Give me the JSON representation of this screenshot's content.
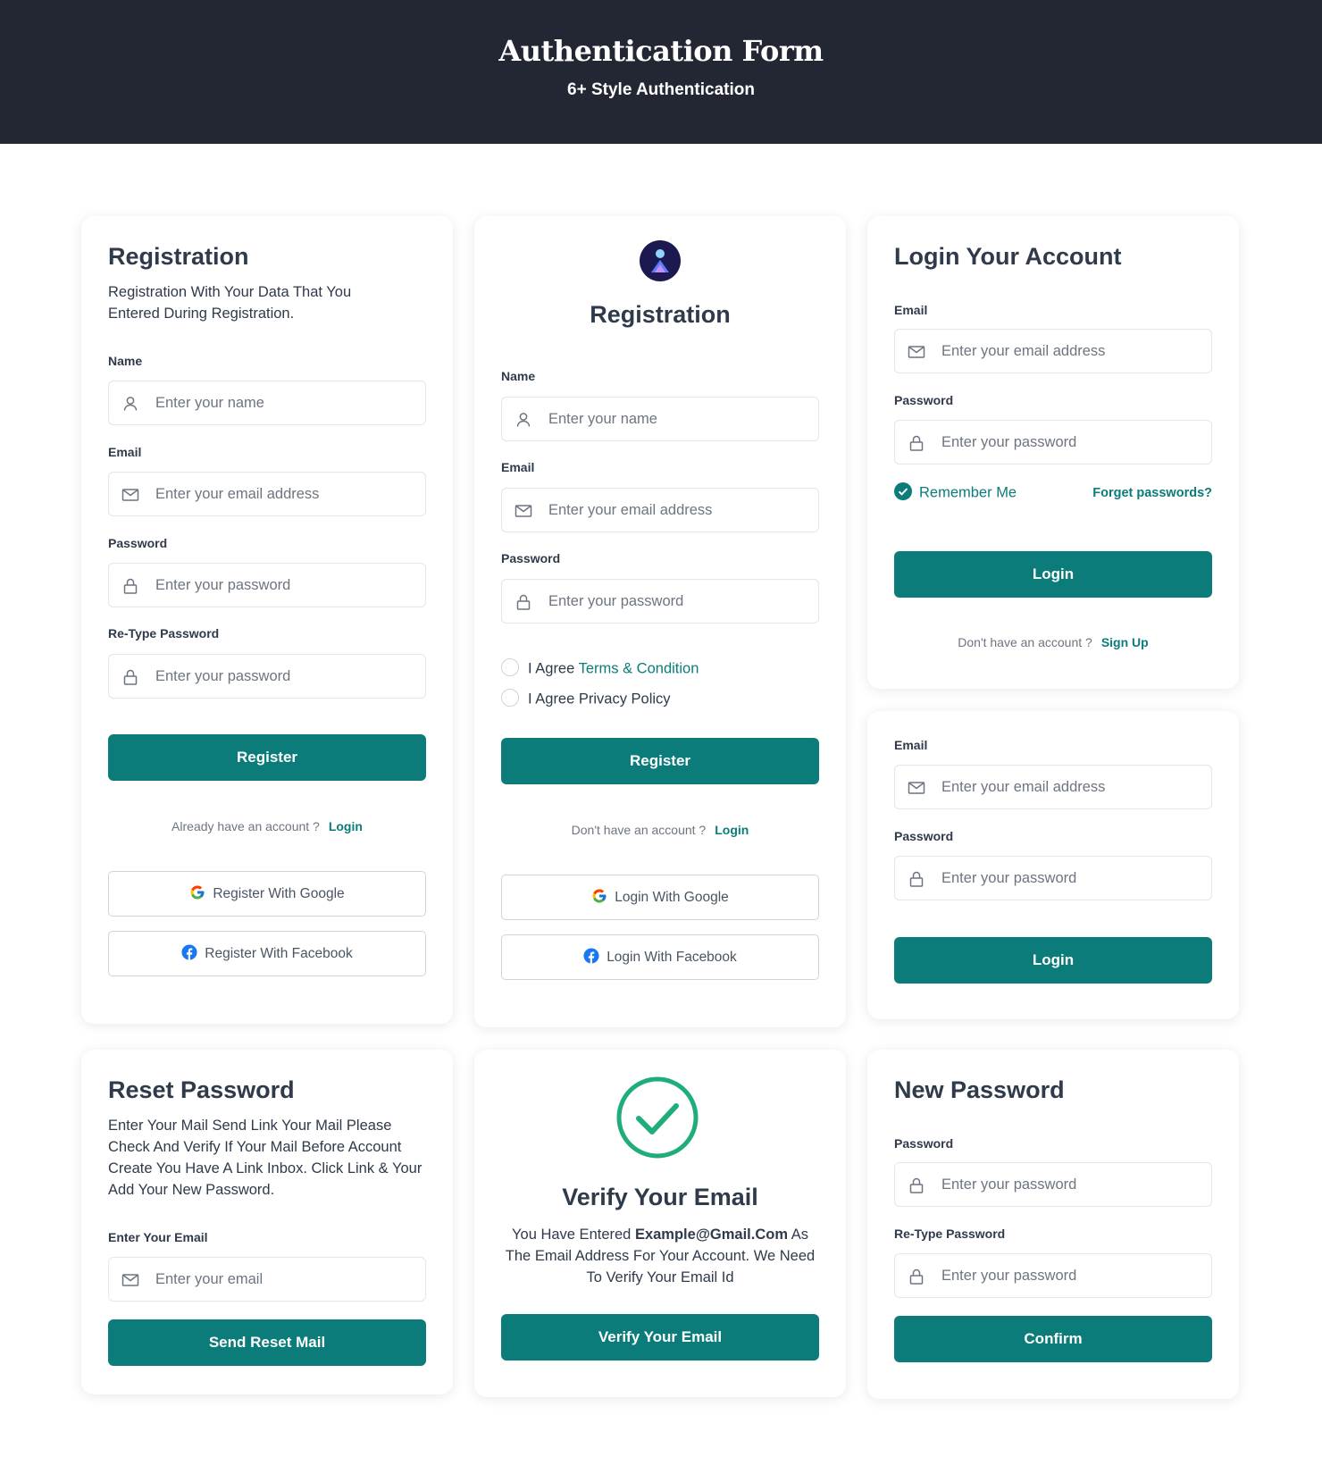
{
  "header": {
    "title": "Authentication Form",
    "subtitle": "6+ Style Authentication"
  },
  "colors": {
    "accent": "#0b7c7a",
    "header_bg": "#222733",
    "success": "#1fae79"
  },
  "registration1": {
    "title": "Registration",
    "description": "Registration With Your Data That You Entered During Registration.",
    "name_label": "Name",
    "name_placeholder": "Enter your name",
    "email_label": "Email",
    "email_placeholder": "Enter your email address",
    "password_label": "Password",
    "password_placeholder": "Enter your password",
    "retype_label": "Re-Type Password",
    "retype_placeholder": "Enter your password",
    "register_button": "Register",
    "account_prompt": "Already have an account ?",
    "login_link": "Login",
    "google_button": "Register With Google",
    "facebook_button": "Register With Facebook"
  },
  "registration2": {
    "logo_icon": "user-logo-icon",
    "title": "Registration",
    "name_label": "Name",
    "name_placeholder": "Enter your name",
    "email_label": "Email",
    "email_placeholder": "Enter your email address",
    "password_label": "Password",
    "password_placeholder": "Enter your password",
    "agree_prefix": "I Agree",
    "terms_link": "Terms & Condition",
    "privacy_text": "I Agree Privacy Policy",
    "register_button": "Register",
    "account_prompt": "Don't have an account ?",
    "login_link": "Login",
    "google_button": "Login With Google",
    "facebook_button": "Login With Facebook"
  },
  "login1": {
    "title": "Login Your Account",
    "email_label": "Email",
    "email_placeholder": "Enter your email address",
    "password_label": "Password",
    "password_placeholder": "Enter your password",
    "remember_label": "Remember Me",
    "remember_checked": true,
    "forgot_link": "Forget passwords?",
    "login_button": "Login",
    "account_prompt": "Don't have an account ?",
    "signup_link": "Sign Up"
  },
  "login2": {
    "email_label": "Email",
    "email_placeholder": "Enter your email address",
    "password_label": "Password",
    "password_placeholder": "Enter your password",
    "login_button": "Login"
  },
  "reset": {
    "title": "Reset Password",
    "description": "Enter Your Mail Send Link Your Mail Please Check And Verify If Your Mail Before Account Create You Have A Link Inbox. Click Link & Your Add Your New Password.",
    "email_label": "Enter Your Email",
    "email_placeholder": "Enter your email",
    "button": "Send Reset Mail"
  },
  "verify": {
    "icon": "check-circle-icon",
    "title": "Verify Your Email",
    "text_prefix": "You Have Entered",
    "email": "Example@Gmail.Com",
    "text_suffix": "As The Email Address For Your Account. We Need To Verify Your Email Id",
    "button": "Verify Your Email"
  },
  "new_password": {
    "title": "New Password",
    "password_label": "Password",
    "password_placeholder": "Enter your password",
    "retype_label": "Re-Type Password",
    "retype_placeholder": "Enter your password",
    "button": "Confirm"
  }
}
